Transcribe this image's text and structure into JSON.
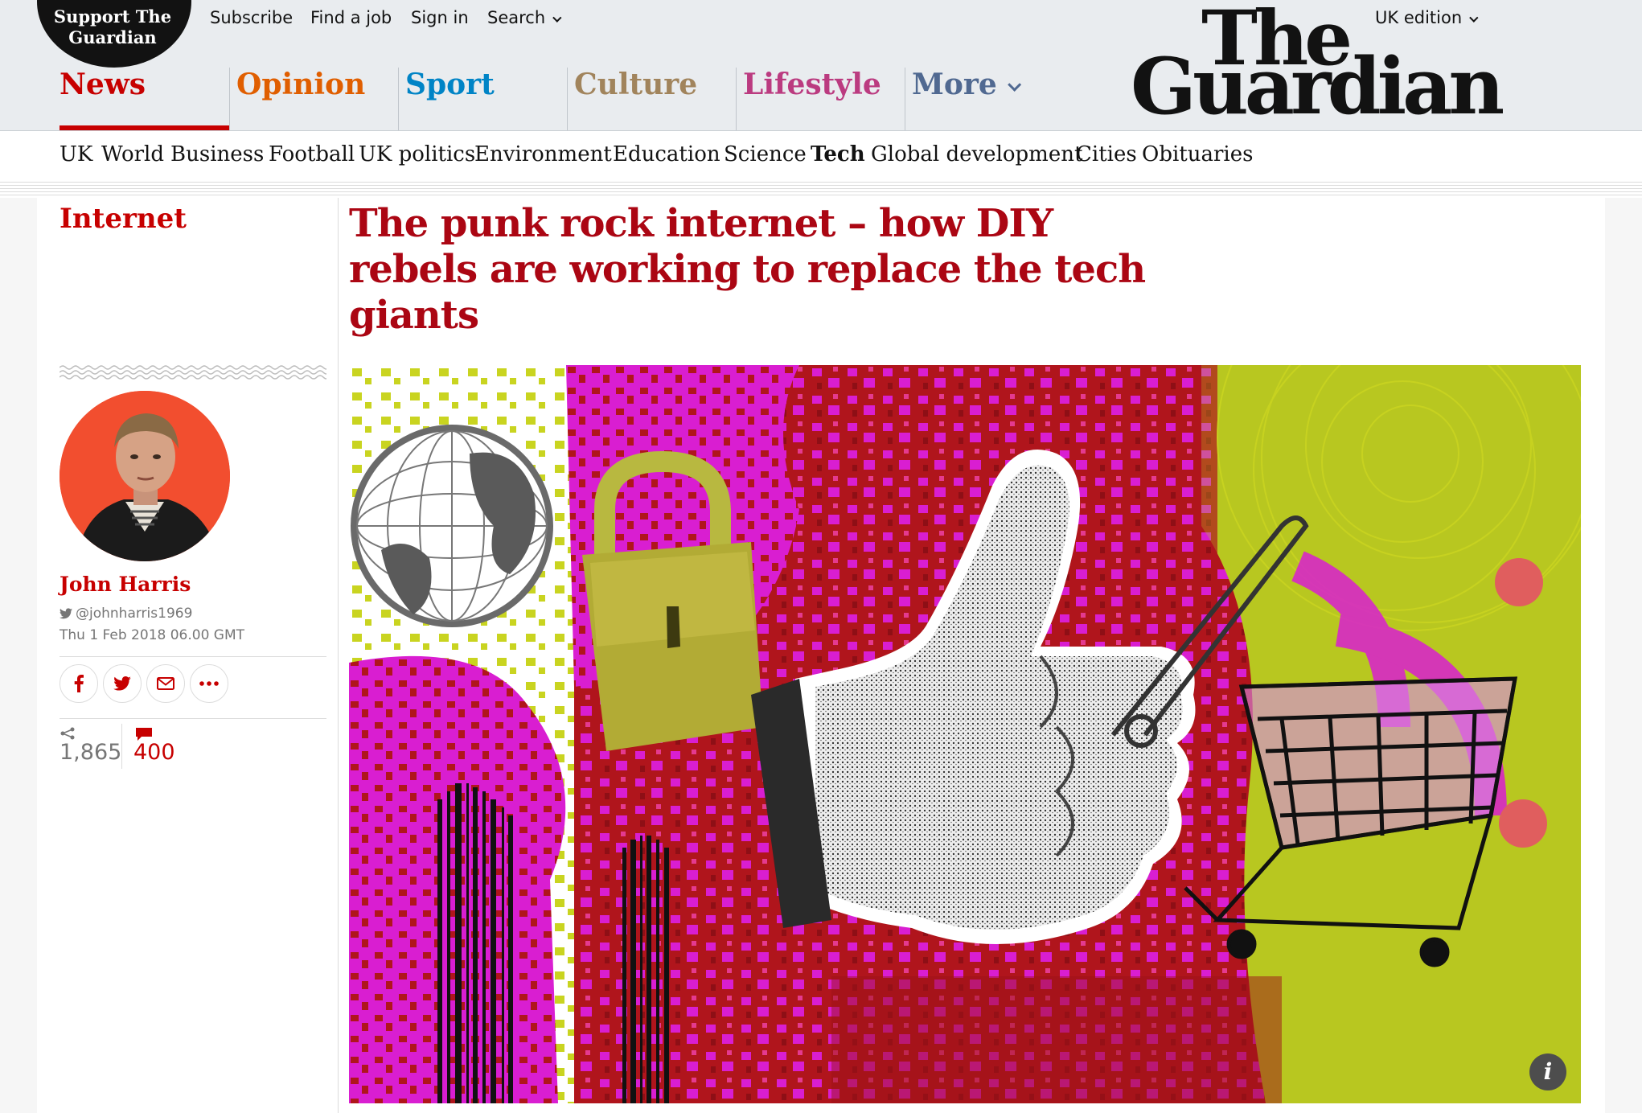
{
  "header": {
    "support": "Support The Guardian",
    "links": [
      {
        "label": "Subscribe"
      },
      {
        "label": "Find a job"
      },
      {
        "label": "Sign in"
      },
      {
        "label": "Search"
      }
    ],
    "edition": "UK edition",
    "logo_the": "The",
    "logo_guardian": "Guardian"
  },
  "pillars": [
    {
      "label": "News",
      "color": "#c70000",
      "active": true
    },
    {
      "label": "Opinion",
      "color": "#e05e00"
    },
    {
      "label": "Sport",
      "color": "#0084c6"
    },
    {
      "label": "Culture",
      "color": "#a1845c"
    },
    {
      "label": "Lifestyle",
      "color": "#bb3b80"
    },
    {
      "label": "More",
      "color": "#506991"
    }
  ],
  "subnav": [
    "UK",
    "World",
    "Business",
    "Football",
    "UK politics",
    "Environment",
    "Education",
    "Science",
    "Tech",
    "Global development",
    "Cities",
    "Obituaries"
  ],
  "subnav_active": "Tech",
  "article": {
    "section": "Internet",
    "headline": "The punk rock internet – how DIY rebels are working to replace the tech giants",
    "author": "John Harris",
    "twitter": "@johnharris1969",
    "date": "Thu 1 Feb 2018 06.00 GMT",
    "share_count": "1,865",
    "comment_count": "400",
    "info_icon": "i"
  },
  "colors": {
    "accent_red": "#c70000",
    "headline_red": "#ab0613",
    "header_bg": "#e9ecef",
    "hero_magenta": "#d91ed1",
    "hero_red": "#b0151c",
    "hero_lime": "#b8c720"
  }
}
